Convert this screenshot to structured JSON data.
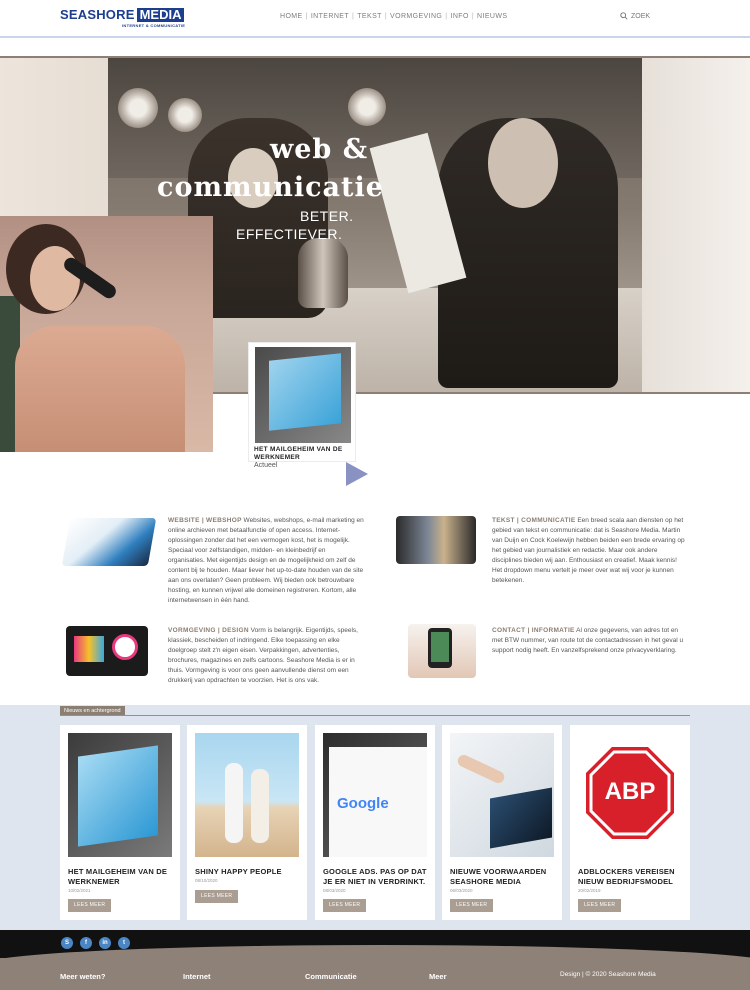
{
  "brand": {
    "name_part1": "SEASHORE",
    "name_part2": "MEDIA",
    "tagline": "INTERNET & COMMUNICATIE"
  },
  "nav": {
    "items": [
      "HOME",
      "INTERNET",
      "TEKST",
      "VORMGEVING",
      "INFO",
      "NIEUWS"
    ],
    "search_label": "ZOEK"
  },
  "hero": {
    "title_line1": "web &",
    "title_line2": "communicatie",
    "sub_line1": "BETER.",
    "sub_line2": "EFFECTIEVER.",
    "feature": {
      "title": "HET MAILGEHEIM VAN DE WERKNEMER",
      "category": "Actueel"
    }
  },
  "services": [
    {
      "heading": "WEBSITE | WEBSHOP",
      "text": "Websites, webshops, e-mail marketing en online archieven met betaalfunctie of open access. Internet-oplossingen zonder dat het een vermogen kost, het is mogelijk. Speciaal voor zelfstandigen, midden- en kleinbedrijf en organisaties. Met eigentijds design en de mogelijkheid om zelf de content bij te houden. Maar liever het up-to-date houden van de site aan ons overlaten? Geen probleem. Wij bieden ook betrouwbare hosting, en kunnen vrijwel alle domeinen registreren. Kortom, alle internetwensen in één hand."
    },
    {
      "heading": "TEKST | COMMUNICATIE",
      "text": "Een breed scala aan diensten op het gebied van tekst en communicatie: dat is Seashore Media. Martin van Duijn en Cock Koelewijn hebben beiden een brede ervaring op het gebied van journalistiek en redactie. Maar ook andere disciplines bieden wij aan. Enthousiast en creatief. Maak kennis! Het dropdown menu vertelt je meer over wat wij voor je kunnen betekenen."
    },
    {
      "heading": "VORMGEVING | DESIGN",
      "text": "Vorm is belangrijk. Eigentijds, speels, klassiek, bescheiden of indringend. Elke toepassing en elke doelgroep stelt z'n eigen eisen. Verpakkingen, advertenties, brochures, magazines en zelfs cartoons. Seashore Media is er in thuis. Vormgeving is voor ons geen aanvullende dienst om een drukkerij van opdrachten te voorzien. Het is ons vak."
    },
    {
      "heading": "CONTACT | INFORMATIE",
      "text": "Al onze gegevens, van adres tot en met BTW nummer, van route tot de contactadressen in het geval u support nodig heeft. En vanzelfsprekend onze privacyverklaring."
    }
  ],
  "news": {
    "section_label": "Nieuws en achtergrond",
    "button_label": "LEES MEER",
    "items": [
      {
        "title": "HET MAILGEHEIM VAN DE WERKNEMER",
        "date": "10/02/2021"
      },
      {
        "title": "SHINY HAPPY PEOPLE",
        "date": "08/10/2020"
      },
      {
        "title": "GOOGLE ADS. PAS OP DAT JE ER NIET IN VERDRINKT.",
        "date": "08/03/2020"
      },
      {
        "title": "NIEUWE VOORWAARDEN SEASHORE MEDIA",
        "date": "06/03/2020"
      },
      {
        "title": "ADBLOCKERS VEREISEN NIEUW BEDRIJFSMODEL",
        "date": "20/02/2019"
      }
    ],
    "abp_text": "ABP",
    "google_text": "Google"
  },
  "footer": {
    "social": [
      "S",
      "f",
      "in",
      "t"
    ],
    "columns": [
      "Meer weten?",
      "Internet",
      "Communicatie",
      "Meer"
    ],
    "copyright": "Design | © 2020 Seashore Media"
  },
  "colors": {
    "brand_blue": "#1d3d8f",
    "accent_taupe": "#8b7f74",
    "news_bg": "#dfe5ef",
    "social_blue": "#4b86c4"
  }
}
